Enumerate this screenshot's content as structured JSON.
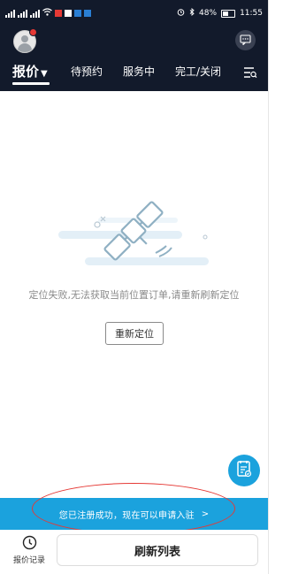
{
  "status_bar": {
    "battery": "48%",
    "time": "11:55"
  },
  "header": {
    "tabs": [
      {
        "label": "报价",
        "active": true
      },
      {
        "label": "待预约",
        "active": false
      },
      {
        "label": "服务中",
        "active": false
      },
      {
        "label": "完工/关闭",
        "active": false
      }
    ],
    "message_icon": "chat-icon",
    "filter_icon": "list-filter-icon"
  },
  "empty_state": {
    "illustration": "satellite-icon",
    "message": "定位失败,无法获取当前位置订单,请重新刷新定位",
    "relocate_button": "重新定位"
  },
  "banner": {
    "text": "您已注册成功，现在可以申请入驻",
    "arrow": ">"
  },
  "bottom_bar": {
    "record_label": "报价记录",
    "refresh_button": "刷新列表"
  },
  "colors": {
    "header_bg": "#121a2b",
    "accent": "#1ba2dd",
    "annotation": "#e53935"
  }
}
